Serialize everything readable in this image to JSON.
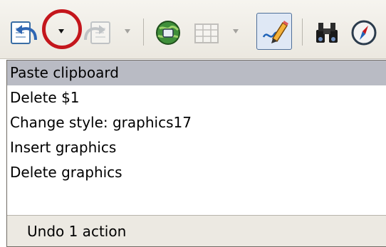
{
  "toolbar": {
    "buttons": [
      {
        "name": "undo-button",
        "icon": "undo-icon",
        "enabled": true
      },
      {
        "name": "undo-dropdown-arrow",
        "icon": "chevron-down-icon",
        "enabled": true,
        "highlighted": true
      },
      {
        "name": "redo-button",
        "icon": "redo-icon",
        "enabled": false
      },
      {
        "name": "redo-dropdown-arrow",
        "icon": "chevron-down-icon",
        "enabled": false
      },
      {
        "name": "navigator-button",
        "icon": "globe-icon",
        "enabled": true
      },
      {
        "name": "table-button",
        "icon": "table-icon",
        "enabled": false
      },
      {
        "name": "table-dropdown-arrow",
        "icon": "chevron-down-icon",
        "enabled": false
      },
      {
        "name": "draw-functions-button",
        "icon": "pencil-icon",
        "enabled": true,
        "active": true
      },
      {
        "name": "find-replace-button",
        "icon": "binoculars-icon",
        "enabled": true
      },
      {
        "name": "navigator-compass-button",
        "icon": "compass-icon",
        "enabled": true
      }
    ],
    "highlight_color": "#c4161c"
  },
  "undo_history": {
    "items": [
      {
        "label": "Paste clipboard",
        "selected": true
      },
      {
        "label": "Delete $1",
        "selected": false
      },
      {
        "label": "Change style: graphics17",
        "selected": false
      },
      {
        "label": "Insert graphics",
        "selected": false
      },
      {
        "label": "Delete graphics",
        "selected": false
      }
    ],
    "status": "Undo 1 action",
    "selected_color": "#b9bbc4"
  }
}
